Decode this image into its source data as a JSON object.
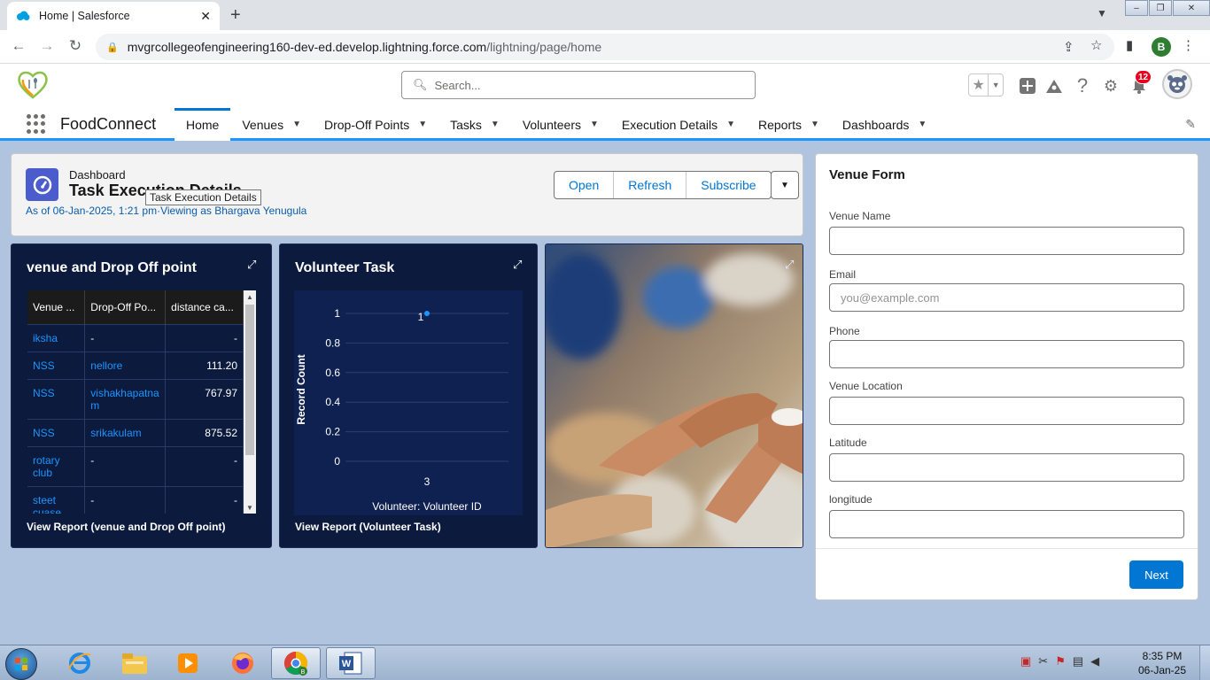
{
  "browser": {
    "tab_title": "Home | Salesforce",
    "tab_close": "✕",
    "new_tab": "+",
    "url_host": "mvgrcollegeofengineering160-dev-ed.develop.lightning.force.com",
    "url_path": "/lightning/page/home",
    "profile_initial": "B"
  },
  "header": {
    "search_placeholder": "Search...",
    "notification_count": "12"
  },
  "nav": {
    "app_name": "FoodConnect",
    "items": [
      {
        "label": "Home",
        "active": true
      },
      {
        "label": "Venues"
      },
      {
        "label": "Drop-Off Points"
      },
      {
        "label": "Tasks"
      },
      {
        "label": "Volunteers"
      },
      {
        "label": "Execution Details"
      },
      {
        "label": "Reports"
      },
      {
        "label": "Dashboards"
      }
    ]
  },
  "dashboard": {
    "label": "Dashboard",
    "title": "Task Execution Details",
    "tooltip": "Task Execution Details",
    "meta": "As of 06-Jan-2025, 1:21 pm·Viewing as Bhargava Yenugula",
    "buttons": {
      "open": "Open",
      "refresh": "Refresh",
      "subscribe": "Subscribe"
    }
  },
  "widget_table": {
    "title": "venue and Drop Off point",
    "columns": [
      "Venue ...",
      "Drop-Off Po...",
      "distance ca..."
    ],
    "rows": [
      [
        "iksha",
        "-",
        "-"
      ],
      [
        "NSS",
        "nellore",
        "111.20"
      ],
      [
        "NSS",
        "vishakhapatna m",
        "767.97"
      ],
      [
        "NSS",
        "srikakulam",
        "875.52"
      ],
      [
        "rotary club",
        "-",
        "-"
      ],
      [
        "steet cuase",
        "-",
        "-"
      ]
    ],
    "link": "View Report (venue and Drop Off point)"
  },
  "widget_chart": {
    "title": "Volunteer Task",
    "link": "View Report (Volunteer Task)"
  },
  "chart_data": {
    "type": "scatter",
    "title": "Volunteer Task",
    "xlabel": "Volunteer: Volunteer ID",
    "ylabel": "Record Count",
    "categories": [
      "3"
    ],
    "values": [
      1
    ],
    "data_labels": [
      "1"
    ],
    "y_ticks": [
      "1",
      "0.8",
      "0.6",
      "0.4",
      "0.2",
      "0"
    ],
    "ylim": [
      0,
      1
    ],
    "grid": true,
    "color": "#1b96ff"
  },
  "venue_form": {
    "title": "Venue Form",
    "fields": [
      {
        "label": "Venue Name",
        "placeholder": ""
      },
      {
        "label": "Email",
        "placeholder": "you@example.com"
      },
      {
        "label": "Phone",
        "placeholder": ""
      },
      {
        "label": "Venue Location",
        "placeholder": ""
      },
      {
        "label": "Latitude",
        "placeholder": ""
      },
      {
        "label": "longitude",
        "placeholder": ""
      }
    ],
    "next": "Next"
  },
  "taskbar": {
    "time": "8:35 PM",
    "date": "06-Jan-25"
  },
  "colors": {
    "accent": "#0176d3",
    "widget_bg": "#0b1a3d",
    "page_bg": "#b0c4df"
  }
}
